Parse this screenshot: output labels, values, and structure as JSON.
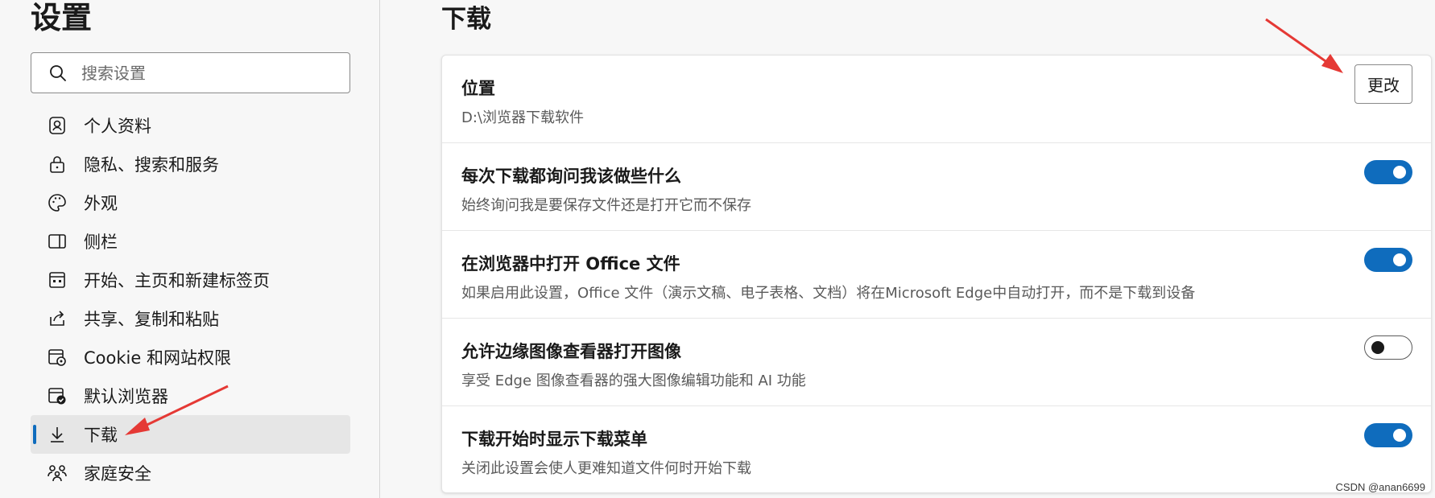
{
  "sidebar": {
    "title": "设置",
    "search_placeholder": "搜索设置",
    "items": [
      {
        "label": "个人资料",
        "icon": "profile-icon"
      },
      {
        "label": "隐私、搜索和服务",
        "icon": "lock-icon"
      },
      {
        "label": "外观",
        "icon": "palette-icon"
      },
      {
        "label": "侧栏",
        "icon": "sidebar-icon"
      },
      {
        "label": "开始、主页和新建标签页",
        "icon": "home-tab-icon"
      },
      {
        "label": "共享、复制和粘贴",
        "icon": "share-icon"
      },
      {
        "label": "Cookie 和网站权限",
        "icon": "cookie-site-icon"
      },
      {
        "label": "默认浏览器",
        "icon": "default-browser-icon"
      },
      {
        "label": "下载",
        "icon": "download-icon",
        "active": true
      },
      {
        "label": "家庭安全",
        "icon": "family-icon"
      }
    ]
  },
  "main": {
    "title": "下载",
    "settings": [
      {
        "title": "位置",
        "description": "D:\\浏览器下载软件",
        "control": "button",
        "button_label": "更改"
      },
      {
        "title": "每次下载都询问我该做些什么",
        "description": "始终询问我是要保存文件还是打开它而不保存",
        "control": "toggle",
        "enabled": true
      },
      {
        "title": "在浏览器中打开 Office 文件",
        "description": "如果启用此设置，Office 文件（演示文稿、电子表格、文档）将在Microsoft Edge中自动打开，而不是下载到设备",
        "control": "toggle",
        "enabled": true
      },
      {
        "title": "允许边缘图像查看器打开图像",
        "description": "享受 Edge 图像查看器的强大图像编辑功能和 AI 功能",
        "control": "toggle",
        "enabled": false
      },
      {
        "title": "下载开始时显示下载菜单",
        "description": "关闭此设置会使人更难知道文件何时开始下载",
        "control": "toggle",
        "enabled": true
      }
    ]
  },
  "watermark": "CSDN @anan6699",
  "colors": {
    "accent": "#0f6cbd",
    "annotation_arrow": "#e53935"
  }
}
